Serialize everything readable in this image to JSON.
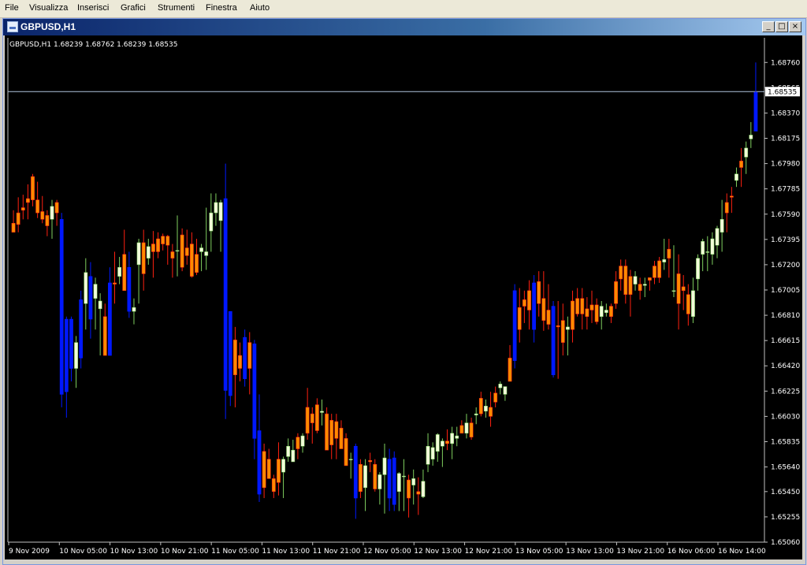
{
  "menu": {
    "items": [
      "File",
      "Visualizza",
      "Inserisci",
      "Grafici",
      "Strumenti",
      "Finestra",
      "Aiuto"
    ]
  },
  "window": {
    "title": "GBPUSD,H1",
    "buttons": {
      "minimize": "_",
      "restore": "□",
      "close": "×"
    }
  },
  "chart_info": {
    "label": "GBPUSD,H1  1.68239 1.68762 1.68239 1.68535"
  },
  "chart_data": {
    "type": "candlestick",
    "symbol": "GBPUSD",
    "timeframe": "H1",
    "ohlc_header": {
      "open": 1.68239,
      "high": 1.68762,
      "low": 1.68239,
      "close": 1.68535
    },
    "current_price": 1.68535,
    "ylim": [
      1.6506,
      1.6895
    ],
    "y_ticks": [
      "1.68760",
      "1.68565",
      "1.68370",
      "1.68175",
      "1.67980",
      "1.67785",
      "1.67590",
      "1.67395",
      "1.67200",
      "1.67005",
      "1.66810",
      "1.66615",
      "1.66420",
      "1.66225",
      "1.66030",
      "1.65835",
      "1.65640",
      "1.65450",
      "1.65255",
      "1.65060"
    ],
    "x_ticks": [
      "9 Nov 2009",
      "10 Nov 05:00",
      "10 Nov 13:00",
      "10 Nov 21:00",
      "11 Nov 05:00",
      "11 Nov 13:00",
      "11 Nov 21:00",
      "12 Nov 05:00",
      "12 Nov 13:00",
      "12 Nov 21:00",
      "13 Nov 05:00",
      "13 Nov 13:00",
      "13 Nov 21:00",
      "16 Nov 06:00",
      "16 Nov 14:00"
    ],
    "colors": {
      "up": "#7fcf5f",
      "down": "#ff2010",
      "up_body": "#f2ffd9",
      "down_body": "#ff8a00",
      "blue": "#0018ff",
      "price_line": "#b0c4de"
    },
    "candles": [
      [
        1.6752,
        1.6762,
        1.6748,
        1.6745
      ],
      [
        1.676,
        1.6772,
        1.6745,
        1.6751
      ],
      [
        1.6764,
        1.6774,
        1.6755,
        1.6762
      ],
      [
        1.6771,
        1.6782,
        1.6755,
        1.6768
      ],
      [
        1.6788,
        1.679,
        1.6765,
        1.677
      ],
      [
        1.677,
        1.6784,
        1.6756,
        1.676
      ],
      [
        1.6761,
        1.6773,
        1.6752,
        1.6755
      ],
      [
        1.6758,
        1.6762,
        1.6742,
        1.675
      ],
      [
        1.6755,
        1.677,
        1.674,
        1.6765
      ],
      [
        1.6768,
        1.677,
        1.675,
        1.676
      ],
      [
        1.6755,
        1.676,
        1.661,
        1.662
      ],
      [
        1.6622,
        1.668,
        1.6602,
        1.6678
      ],
      [
        1.6678,
        1.668,
        1.663,
        1.664
      ],
      [
        1.664,
        1.6665,
        1.6625,
        1.666
      ],
      [
        1.6648,
        1.67,
        1.664,
        1.6693
      ],
      [
        1.669,
        1.6725,
        1.667,
        1.6714
      ],
      [
        1.6711,
        1.6722,
        1.6663,
        1.6678
      ],
      [
        1.6694,
        1.671,
        1.667,
        1.6705
      ],
      [
        1.6686,
        1.6698,
        1.665,
        1.6692
      ],
      [
        1.668,
        1.669,
        1.665,
        1.665
      ],
      [
        1.6706,
        1.6718,
        1.665,
        1.665
      ],
      [
        1.6706,
        1.673,
        1.669,
        1.6705
      ],
      [
        1.6711,
        1.6726,
        1.6705,
        1.6718
      ],
      [
        1.6728,
        1.6747,
        1.67,
        1.67
      ],
      [
        1.6684,
        1.673,
        1.6679,
        1.6718
      ],
      [
        1.6684,
        1.6694,
        1.6674,
        1.6687
      ],
      [
        1.672,
        1.674,
        1.669,
        1.6737
      ],
      [
        1.6737,
        1.6747,
        1.67,
        1.6713
      ],
      [
        1.6725,
        1.674,
        1.672,
        1.6734
      ],
      [
        1.6736,
        1.6746,
        1.671,
        1.673
      ],
      [
        1.674,
        1.6745,
        1.6725,
        1.673
      ],
      [
        1.6742,
        1.6744,
        1.6731,
        1.6736
      ],
      [
        1.6742,
        1.6743,
        1.672,
        1.6735
      ],
      [
        1.673,
        1.6736,
        1.671,
        1.6725
      ],
      [
        1.6731,
        1.6758,
        1.6711,
        1.6731
      ],
      [
        1.6743,
        1.6748,
        1.6715,
        1.6718
      ],
      [
        1.6733,
        1.6747,
        1.672,
        1.6727
      ],
      [
        1.6736,
        1.6745,
        1.671,
        1.6711
      ],
      [
        1.6728,
        1.674,
        1.6712,
        1.6714
      ],
      [
        1.673,
        1.6736,
        1.6715,
        1.6733
      ],
      [
        1.6727,
        1.6764,
        1.6716,
        1.673
      ],
      [
        1.6746,
        1.6775,
        1.673,
        1.676
      ],
      [
        1.676,
        1.6775,
        1.675,
        1.6768
      ],
      [
        1.6754,
        1.677,
        1.673,
        1.6768
      ],
      [
        1.6771,
        1.6798,
        1.6601,
        1.6623
      ],
      [
        1.6684,
        1.6684,
        1.6611,
        1.6619
      ],
      [
        1.6662,
        1.6672,
        1.661,
        1.6635
      ],
      [
        1.665,
        1.666,
        1.663,
        1.664
      ],
      [
        1.6664,
        1.667,
        1.6626,
        1.6632
      ],
      [
        1.666,
        1.6668,
        1.662,
        1.664
      ],
      [
        1.6659,
        1.6662,
        1.657,
        1.6586
      ],
      [
        1.6592,
        1.662,
        1.6537,
        1.6543
      ],
      [
        1.6576,
        1.6582,
        1.654,
        1.6548
      ],
      [
        1.657,
        1.6578,
        1.6555,
        1.6555
      ],
      [
        1.6555,
        1.6558,
        1.654,
        1.6545
      ],
      [
        1.657,
        1.6583,
        1.6542,
        1.6552
      ],
      [
        1.656,
        1.6572,
        1.654,
        1.657
      ],
      [
        1.6572,
        1.6586,
        1.6568,
        1.658
      ],
      [
        1.6568,
        1.6585,
        1.6568,
        1.6577
      ],
      [
        1.6587,
        1.659,
        1.657,
        1.6578
      ],
      [
        1.658,
        1.659,
        1.6575,
        1.6588
      ],
      [
        1.661,
        1.6625,
        1.6585,
        1.659
      ],
      [
        1.6605,
        1.661,
        1.6582,
        1.6598
      ],
      [
        1.6612,
        1.6617,
        1.659,
        1.6592
      ],
      [
        1.6606,
        1.6616,
        1.6596,
        1.6607
      ],
      [
        1.6605,
        1.661,
        1.6577,
        1.6577
      ],
      [
        1.66,
        1.6605,
        1.657,
        1.6581
      ],
      [
        1.6599,
        1.6605,
        1.657,
        1.6586
      ],
      [
        1.6594,
        1.66,
        1.6578,
        1.6578
      ],
      [
        1.6586,
        1.659,
        1.6565,
        1.6565
      ],
      [
        1.657,
        1.6575,
        1.6555,
        1.657
      ],
      [
        1.658,
        1.6582,
        1.6524,
        1.654
      ],
      [
        1.6566,
        1.657,
        1.654,
        1.6545
      ],
      [
        1.6548,
        1.657,
        1.653,
        1.6565
      ],
      [
        1.6569,
        1.6575,
        1.656,
        1.6568
      ],
      [
        1.6566,
        1.657,
        1.6545,
        1.6547
      ],
      [
        1.6547,
        1.656,
        1.6535,
        1.6558
      ],
      [
        1.6558,
        1.6582,
        1.6528,
        1.6571
      ],
      [
        1.654,
        1.6578,
        1.653,
        1.657
      ],
      [
        1.6571,
        1.6576,
        1.653,
        1.6535
      ],
      [
        1.6545,
        1.656,
        1.653,
        1.6559
      ],
      [
        1.6557,
        1.657,
        1.653,
        1.6557
      ],
      [
        1.6554,
        1.6558,
        1.6525,
        1.654
      ],
      [
        1.655,
        1.6562,
        1.6535,
        1.6555
      ],
      [
        1.6545,
        1.6556,
        1.6527,
        1.6543
      ],
      [
        1.6541,
        1.6562,
        1.654,
        1.6553
      ],
      [
        1.6566,
        1.659,
        1.656,
        1.658
      ],
      [
        1.657,
        1.6583,
        1.6565,
        1.6579
      ],
      [
        1.6576,
        1.659,
        1.6568,
        1.6589
      ],
      [
        1.658,
        1.6586,
        1.6564,
        1.6584
      ],
      [
        1.6584,
        1.6593,
        1.6577,
        1.6582
      ],
      [
        1.6582,
        1.6595,
        1.657,
        1.659
      ],
      [
        1.6586,
        1.6595,
        1.658,
        1.6588
      ],
      [
        1.6596,
        1.66,
        1.659,
        1.659
      ],
      [
        1.659,
        1.6605,
        1.6586,
        1.6598
      ],
      [
        1.6598,
        1.6602,
        1.6585,
        1.6587
      ],
      [
        1.6604,
        1.661,
        1.6597,
        1.6605
      ],
      [
        1.6617,
        1.6622,
        1.6603,
        1.6605
      ],
      [
        1.6607,
        1.6616,
        1.6602,
        1.6611
      ],
      [
        1.661,
        1.6622,
        1.6595,
        1.6603
      ],
      [
        1.6621,
        1.6626,
        1.661,
        1.6614
      ],
      [
        1.6625,
        1.663,
        1.662,
        1.6628
      ],
      [
        1.662,
        1.6626,
        1.6615,
        1.6626
      ],
      [
        1.6648,
        1.6658,
        1.663,
        1.663
      ],
      [
        1.6646,
        1.6705,
        1.664,
        1.67
      ],
      [
        1.6687,
        1.6702,
        1.666,
        1.667
      ],
      [
        1.6693,
        1.67,
        1.6675,
        1.6688
      ],
      [
        1.67,
        1.6708,
        1.667,
        1.6685
      ],
      [
        1.6706,
        1.6712,
        1.666,
        1.667
      ],
      [
        1.6707,
        1.6715,
        1.668,
        1.669
      ],
      [
        1.6694,
        1.6715,
        1.6669,
        1.6677
      ],
      [
        1.6685,
        1.6705,
        1.667,
        1.6674
      ],
      [
        1.6688,
        1.6692,
        1.6633,
        1.6635
      ],
      [
        1.6673,
        1.6692,
        1.6632,
        1.6672
      ],
      [
        1.6677,
        1.669,
        1.665,
        1.666
      ],
      [
        1.667,
        1.668,
        1.665,
        1.6672
      ],
      [
        1.6692,
        1.67,
        1.666,
        1.667
      ],
      [
        1.6694,
        1.6702,
        1.668,
        1.6682
      ],
      [
        1.6694,
        1.6702,
        1.667,
        1.6682
      ],
      [
        1.6686,
        1.6695,
        1.667,
        1.668
      ],
      [
        1.6689,
        1.67,
        1.6675,
        1.6685
      ],
      [
        1.6689,
        1.6694,
        1.6674,
        1.6676
      ],
      [
        1.668,
        1.6692,
        1.667,
        1.6688
      ],
      [
        1.6683,
        1.669,
        1.668,
        1.6685
      ],
      [
        1.6688,
        1.669,
        1.6675,
        1.668
      ],
      [
        1.6707,
        1.6715,
        1.6686,
        1.669
      ],
      [
        1.6719,
        1.6724,
        1.67,
        1.6709
      ],
      [
        1.6719,
        1.6724,
        1.669,
        1.6697
      ],
      [
        1.6711,
        1.6716,
        1.668,
        1.6697
      ],
      [
        1.6705,
        1.6715,
        1.67,
        1.6711
      ],
      [
        1.6705,
        1.671,
        1.6693,
        1.67
      ],
      [
        1.6704,
        1.671,
        1.6695,
        1.6705
      ],
      [
        1.671,
        1.671,
        1.67,
        1.6708
      ],
      [
        1.6719,
        1.6723,
        1.6705,
        1.671
      ],
      [
        1.6723,
        1.6726,
        1.6706,
        1.671
      ],
      [
        1.6722,
        1.674,
        1.6716,
        1.6724
      ],
      [
        1.6732,
        1.674,
        1.671,
        1.6725
      ],
      [
        1.67,
        1.6735,
        1.6695,
        1.67
      ],
      [
        1.6713,
        1.6728,
        1.667,
        1.669
      ],
      [
        1.6703,
        1.6712,
        1.6685,
        1.67
      ],
      [
        1.6697,
        1.6705,
        1.6673,
        1.6682
      ],
      [
        1.668,
        1.671,
        1.6675,
        1.67
      ],
      [
        1.6709,
        1.6728,
        1.67,
        1.6725
      ],
      [
        1.6728,
        1.674,
        1.6715,
        1.6738
      ],
      [
        1.673,
        1.6742,
        1.6715,
        1.673
      ],
      [
        1.6728,
        1.6745,
        1.672,
        1.674
      ],
      [
        1.6735,
        1.675,
        1.6725,
        1.6748
      ],
      [
        1.6745,
        1.677,
        1.673,
        1.6755
      ],
      [
        1.6768,
        1.6775,
        1.6745,
        1.676
      ],
      [
        1.6773,
        1.678,
        1.676,
        1.6772
      ],
      [
        1.6785,
        1.6795,
        1.678,
        1.679
      ],
      [
        1.68,
        1.681,
        1.678,
        1.6795
      ],
      [
        1.6803,
        1.6815,
        1.679,
        1.681
      ],
      [
        1.6817,
        1.683,
        1.681,
        1.682
      ],
      [
        1.6823,
        1.6876,
        1.6823,
        1.6853
      ]
    ]
  }
}
